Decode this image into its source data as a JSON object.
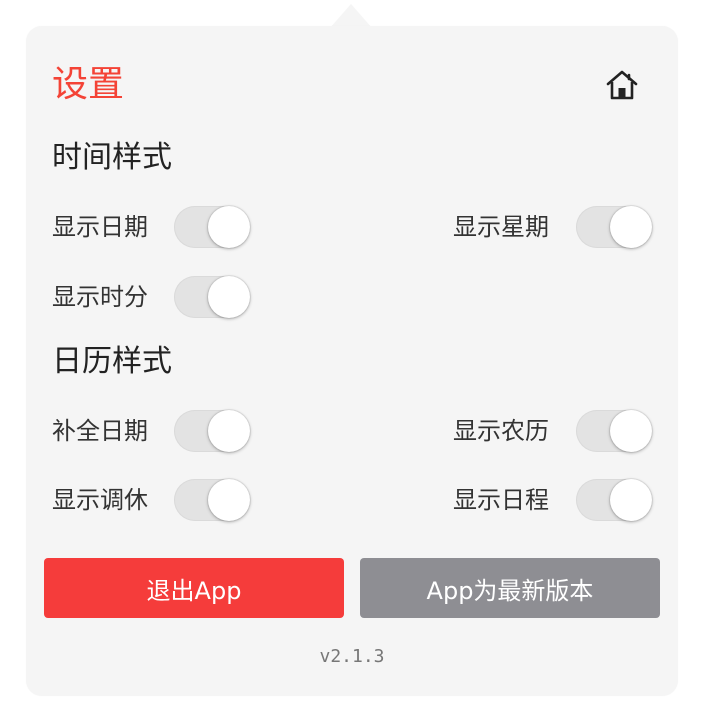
{
  "title": "设置",
  "accent_color": "#f44336",
  "header": {
    "home_icon": "home-icon"
  },
  "sections": [
    {
      "title": "时间样式",
      "toggles": [
        {
          "label": "显示日期",
          "on": false
        },
        {
          "label": "显示星期",
          "on": false
        },
        {
          "label": "显示时分",
          "on": false
        }
      ]
    },
    {
      "title": "日历样式",
      "toggles": [
        {
          "label": "补全日期",
          "on": false
        },
        {
          "label": "显示农历",
          "on": false
        },
        {
          "label": "显示调休",
          "on": false
        },
        {
          "label": "显示日程",
          "on": false
        }
      ]
    }
  ],
  "buttons": {
    "exit_label": "退出App",
    "exit_color": "#f53c3b",
    "update_label": "App为最新版本",
    "update_color": "#8e8e93"
  },
  "version": "v2.1.3"
}
